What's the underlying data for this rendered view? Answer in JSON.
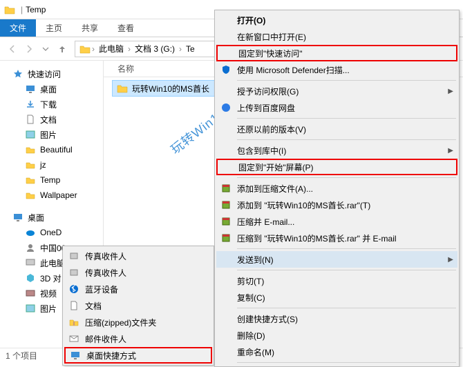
{
  "titlebar": {
    "title": "Temp"
  },
  "ribbon": {
    "file": "文件",
    "home": "主页",
    "share": "共享",
    "view": "查看"
  },
  "breadcrumb": {
    "c1": "此电脑",
    "c2": "文档 3 (G:)",
    "c3": "Te"
  },
  "sidebar": {
    "quick": "快速访问",
    "items1": [
      "桌面",
      "下载",
      "文档",
      "图片",
      "Beautiful",
      "jz",
      "Temp",
      "Wallpaper"
    ],
    "desktop_hdr": "桌面",
    "items2": [
      "OneD",
      "中国00",
      "此电脑",
      "3D 对",
      "视频",
      "图片"
    ]
  },
  "content": {
    "name_col": "名称",
    "selected_file": "玩转Win10的MS酋长"
  },
  "statusbar": {
    "text": "1 个项目"
  },
  "watermark": "玩转Win10的MS酋长",
  "submenu": {
    "items": [
      "传真收件人",
      "传真收件人",
      "蓝牙设备",
      "文档",
      "压缩(zipped)文件夹",
      "邮件收件人",
      "桌面快捷方式"
    ]
  },
  "mainmenu": {
    "open": "打开(O)",
    "newwin": "在新窗口中打开(E)",
    "pin_quick": "固定到\"快速访问\"",
    "defender": "使用 Microsoft Defender扫描...",
    "grant": "授予访问权限(G)",
    "baidu": "上传到百度网盘",
    "restore": "还原以前的版本(V)",
    "library": "包含到库中(I)",
    "pin_start": "固定到\"开始\"屏幕(P)",
    "addrar": "添加到压缩文件(A)...",
    "addrar2": "添加到 \"玩转Win10的MS酋长.rar\"(T)",
    "email": "压缩并 E-mail...",
    "raremail": "压缩到 \"玩转Win10的MS酋长.rar\" 并 E-mail",
    "sendto": "发送到(N)",
    "cut": "剪切(T)",
    "copy": "复制(C)",
    "shortcut": "创建快捷方式(S)",
    "delete": "删除(D)",
    "rename": "重命名(M)"
  }
}
